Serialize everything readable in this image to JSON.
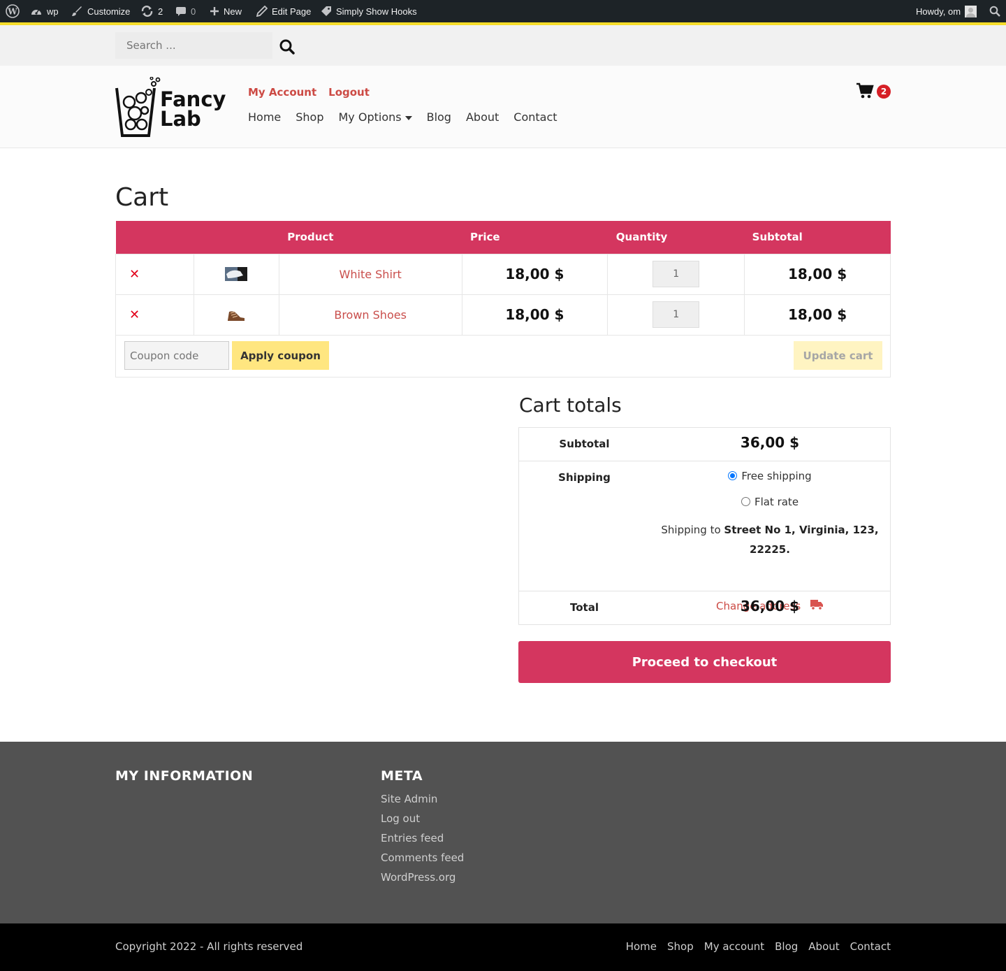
{
  "admin_bar": {
    "site": "wp",
    "customize": "Customize",
    "updates": "2",
    "comments": "0",
    "new": "New",
    "edit_page": "Edit Page",
    "hooks": "Simply Show Hooks",
    "howdy": "Howdy, om"
  },
  "search": {
    "placeholder": "Search ..."
  },
  "header": {
    "logo_line1": "Fancy",
    "logo_line2": "Lab",
    "account_links": [
      "My Account",
      "Logout"
    ],
    "nav": [
      "Home",
      "Shop",
      "My Options",
      "Blog",
      "About",
      "Contact"
    ],
    "cart_count": "2"
  },
  "cart": {
    "title": "Cart",
    "columns": [
      "Product",
      "Price",
      "Quantity",
      "Subtotal"
    ],
    "items": [
      {
        "name": "White Shirt",
        "price": "18,00 $",
        "qty": "1",
        "subtotal": "18,00 $"
      },
      {
        "name": "Brown Shoes",
        "price": "18,00 $",
        "qty": "1",
        "subtotal": "18,00 $"
      }
    ],
    "coupon_placeholder": "Coupon code",
    "apply_coupon": "Apply coupon",
    "update_cart": "Update cart"
  },
  "totals": {
    "title": "Cart totals",
    "subtotal_label": "Subtotal",
    "subtotal": "36,00 $",
    "shipping_label": "Shipping",
    "shipping_options": [
      "Free shipping",
      "Flat rate"
    ],
    "selected_shipping": "Free shipping",
    "shipping_to_prefix": "Shipping to",
    "shipping_address": "Street No 1, Virginia, 123, 22225",
    "change_address": "Change address",
    "total_label": "Total",
    "total": "36,00 $",
    "checkout": "Proceed to checkout"
  },
  "footer": {
    "widget1_title": "MY INFORMATION",
    "widget2_title": "META",
    "meta_links": [
      "Site Admin",
      "Log out",
      "Entries feed",
      "Comments feed",
      "WordPress.org"
    ],
    "copyright": "Copyright 2022 - All rights reserved",
    "nav": [
      "Home",
      "Shop",
      "My account",
      "Blog",
      "About",
      "Contact"
    ]
  },
  "colors": {
    "accent": "#d4365f",
    "link": "#cc4a44",
    "coupon_button": "#ffe680",
    "admin_bar": "#1d2327",
    "footer": "#525252"
  }
}
